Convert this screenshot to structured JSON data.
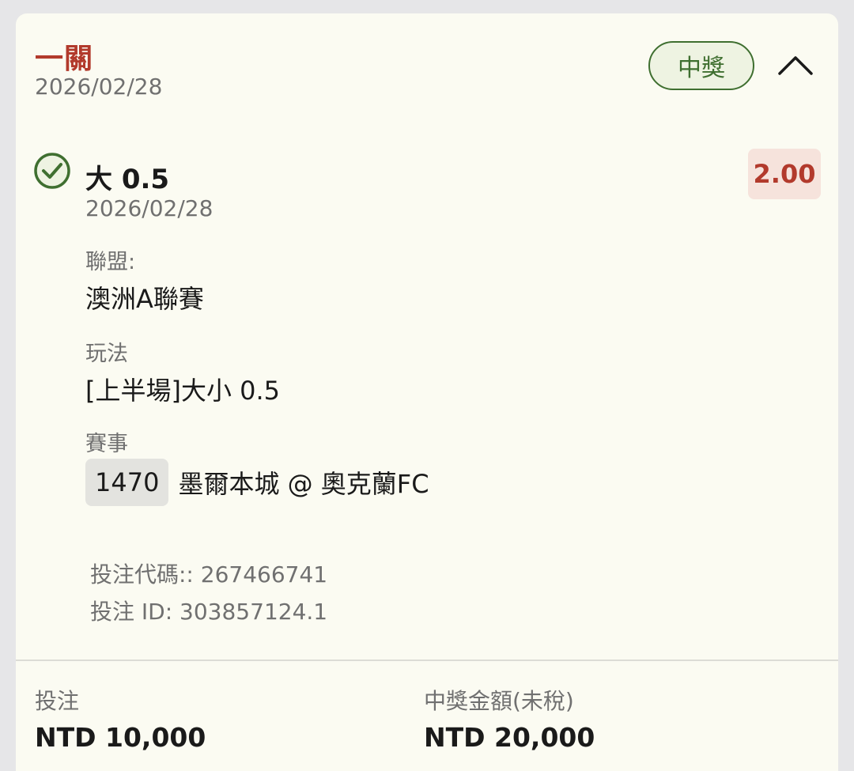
{
  "header": {
    "bet_type": "一關",
    "date": "2026/02/28",
    "status_badge": "中獎",
    "collapse_icon": "chevron-up-icon"
  },
  "selection": {
    "status_icon": "check-circle-icon",
    "name": "大 0.5",
    "odds": "2.00",
    "date": "2026/02/28",
    "league_label": "聯盟:",
    "league": "澳洲A聯賽",
    "market_label": "玩法",
    "market": "[上半場]大小 0.5",
    "event_label": "賽事",
    "event_number": "1470",
    "event_name": "墨爾本城 @ 奧克蘭FC"
  },
  "bet_info": {
    "code_line": "投注代碼:: 267466741",
    "id_line": "投注 ID: 303857124.1"
  },
  "footer": {
    "stake_label": "投注",
    "stake_value": "NTD 10,000",
    "win_label": "中獎金額(未稅)",
    "win_value": "NTD 20,000"
  },
  "colors": {
    "accent_red": "#b23a2c",
    "win_green": "#3f6f30",
    "card_bg": "#fbfbf2"
  }
}
